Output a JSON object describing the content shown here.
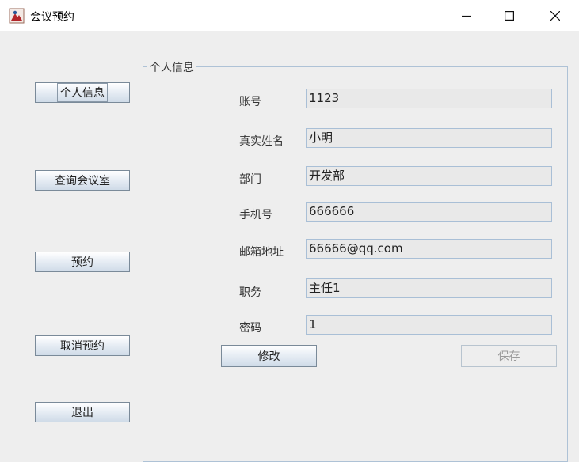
{
  "window": {
    "title": "会议预约"
  },
  "sidebar": {
    "items": [
      {
        "label": "个人信息"
      },
      {
        "label": "查询会议室"
      },
      {
        "label": "预约"
      },
      {
        "label": "取消预约"
      },
      {
        "label": "退出"
      }
    ]
  },
  "panel": {
    "title": "个人信息",
    "fields": [
      {
        "label": "账号",
        "value": "1123"
      },
      {
        "label": "真实姓名",
        "value": "小明"
      },
      {
        "label": "部门",
        "value": "开发部"
      },
      {
        "label": "手机号",
        "value": "666666"
      },
      {
        "label": "邮箱地址",
        "value": "66666@qq.com"
      },
      {
        "label": "职务",
        "value": "主任1"
      },
      {
        "label": "密码",
        "value": "1"
      }
    ],
    "edit_label": "修改",
    "save_label": "保存"
  }
}
